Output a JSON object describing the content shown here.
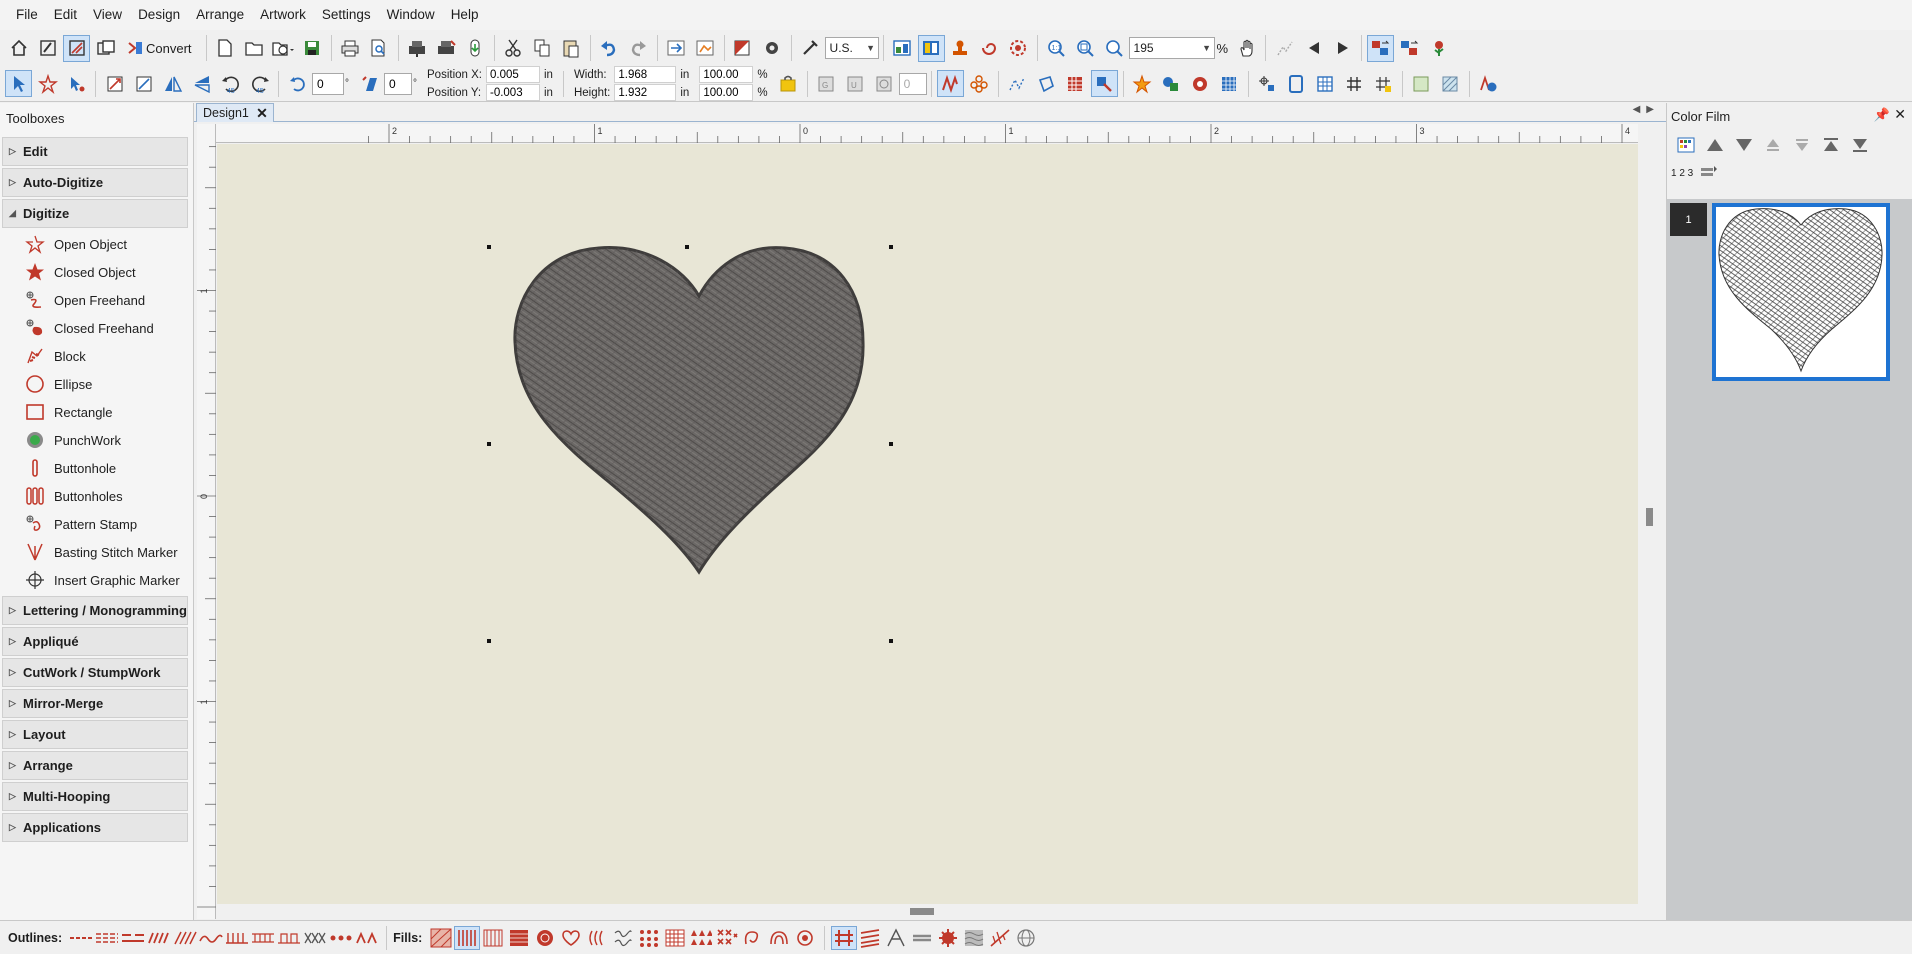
{
  "menu": [
    "File",
    "Edit",
    "View",
    "Design",
    "Arrange",
    "Artwork",
    "Settings",
    "Window",
    "Help"
  ],
  "toolbar1": {
    "convert_label": "Convert",
    "measure_unit": "U.S.",
    "zoom_value": "195",
    "zoom_unit": "%"
  },
  "toolbar2": {
    "rotate_value": "0",
    "slant_value": "0",
    "angle_value": "0",
    "position_x_label": "Position X:",
    "position_x_value": "0.005",
    "position_y_label": "Position Y:",
    "position_y_value": "-0.003",
    "width_label": "Width:",
    "width_value": "1.968",
    "height_label": "Height:",
    "height_value": "1.932",
    "unit_in": "in",
    "width_pct": "100.00",
    "height_pct": "100.00",
    "pct": "%",
    "degree": "°"
  },
  "toolboxes": {
    "title": "Toolboxes",
    "sections_top": [
      "Edit",
      "Auto-Digitize",
      "Digitize"
    ],
    "digitize_items": [
      {
        "label": "Open Object",
        "icon": "open-object-icon"
      },
      {
        "label": "Closed Object",
        "icon": "closed-object-icon"
      },
      {
        "label": "Open Freehand",
        "icon": "open-freehand-icon"
      },
      {
        "label": "Closed Freehand",
        "icon": "closed-freehand-icon"
      },
      {
        "label": "Block",
        "icon": "block-icon"
      },
      {
        "label": "Ellipse",
        "icon": "ellipse-icon"
      },
      {
        "label": "Rectangle",
        "icon": "rectangle-icon"
      },
      {
        "label": "PunchWork",
        "icon": "punchwork-icon"
      },
      {
        "label": "Buttonhole",
        "icon": "buttonhole-icon"
      },
      {
        "label": "Buttonholes",
        "icon": "buttonholes-icon"
      },
      {
        "label": "Pattern Stamp",
        "icon": "pattern-stamp-icon"
      },
      {
        "label": "Basting Stitch Marker",
        "icon": "basting-stitch-icon"
      },
      {
        "label": "Insert Graphic Marker",
        "icon": "insert-graphic-marker-icon"
      }
    ],
    "sections_bottom": [
      "Lettering / Monogramming",
      "Appliqué",
      "CutWork / StumpWork",
      "Mirror-Merge",
      "Layout",
      "Arrange",
      "Multi-Hooping",
      "Applications"
    ]
  },
  "document": {
    "tab_label": "Design1",
    "ruler_h_labels": [
      "2",
      "1",
      "0",
      "1",
      "2",
      "3",
      "4"
    ],
    "ruler_v_labels": [
      "1",
      "0",
      "1"
    ],
    "design_color": "#6e6b69",
    "canvas_color": "#e8e6d6"
  },
  "color_film": {
    "title": "Color Film",
    "sequence_label": "1 2 3",
    "item_number": "1"
  },
  "bottom": {
    "outlines_label": "Outlines:",
    "fills_label": "Fills:"
  }
}
